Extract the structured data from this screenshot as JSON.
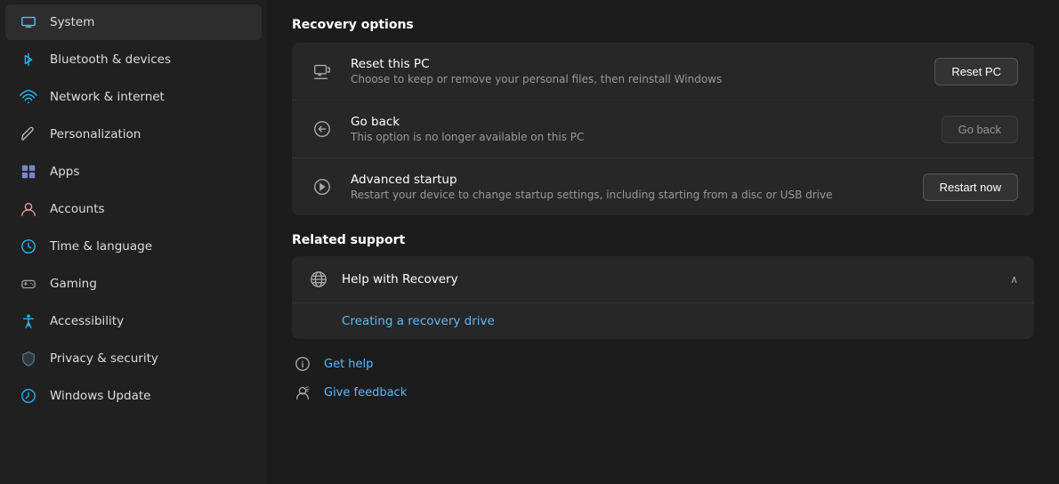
{
  "sidebar": {
    "items": [
      {
        "id": "system",
        "label": "System",
        "active": true
      },
      {
        "id": "bluetooth",
        "label": "Bluetooth & devices",
        "active": false
      },
      {
        "id": "network",
        "label": "Network & internet",
        "active": false
      },
      {
        "id": "personalization",
        "label": "Personalization",
        "active": false
      },
      {
        "id": "apps",
        "label": "Apps",
        "active": false
      },
      {
        "id": "accounts",
        "label": "Accounts",
        "active": false
      },
      {
        "id": "time",
        "label": "Time & language",
        "active": false
      },
      {
        "id": "gaming",
        "label": "Gaming",
        "active": false
      },
      {
        "id": "accessibility",
        "label": "Accessibility",
        "active": false
      },
      {
        "id": "privacy",
        "label": "Privacy & security",
        "active": false
      },
      {
        "id": "update",
        "label": "Windows Update",
        "active": false
      }
    ]
  },
  "main": {
    "recovery_options_title": "Recovery options",
    "rows": [
      {
        "id": "reset-pc",
        "title": "Reset this PC",
        "desc": "Choose to keep or remove your personal files, then reinstall Windows",
        "button_label": "Reset PC",
        "disabled": false
      },
      {
        "id": "go-back",
        "title": "Go back",
        "desc": "This option is no longer available on this PC",
        "button_label": "Go back",
        "disabled": true
      },
      {
        "id": "advanced-startup",
        "title": "Advanced startup",
        "desc": "Restart your device to change startup settings, including starting from a disc or USB drive",
        "button_label": "Restart now",
        "disabled": false
      }
    ],
    "related_support_title": "Related support",
    "help_recovery_label": "Help with Recovery",
    "creating_recovery_link": "Creating a recovery drive",
    "bottom_links": [
      {
        "id": "get-help",
        "label": "Get help"
      },
      {
        "id": "give-feedback",
        "label": "Give feedback"
      }
    ]
  }
}
